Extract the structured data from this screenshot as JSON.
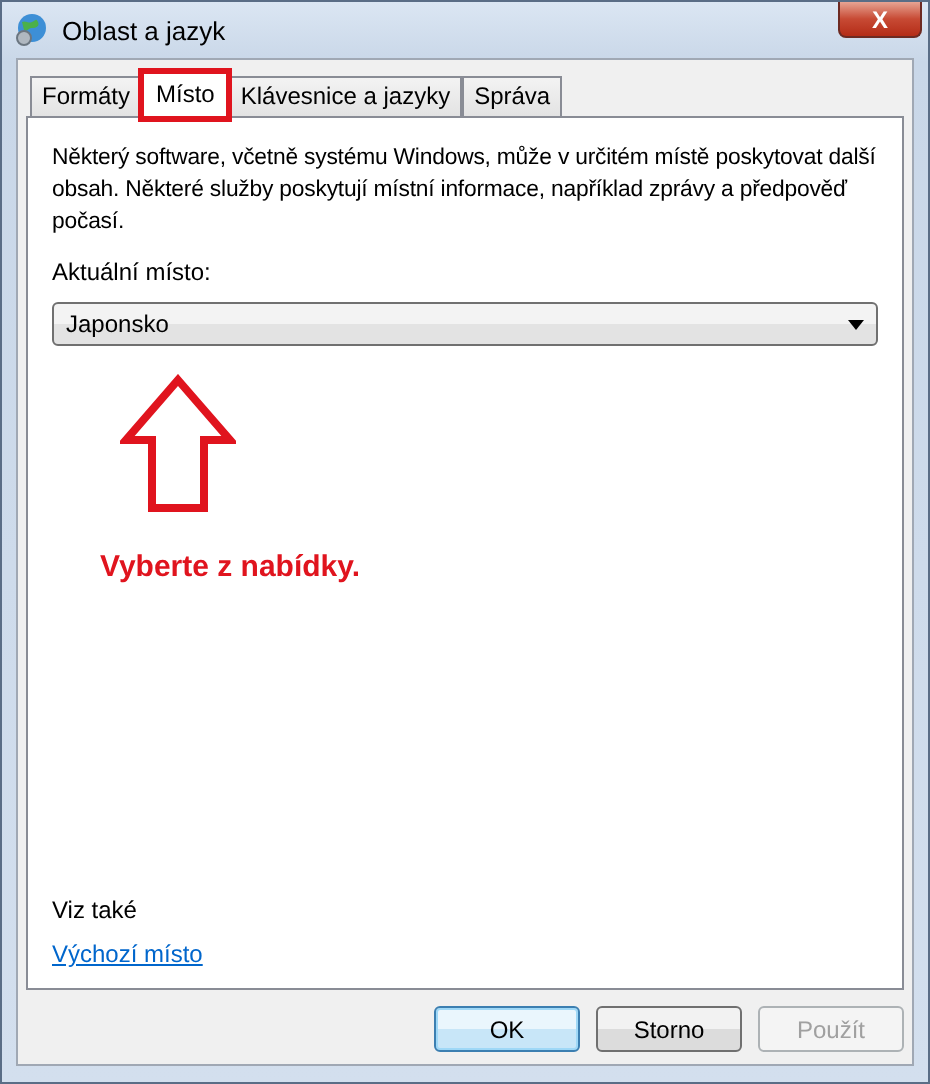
{
  "window": {
    "title": "Oblast a jazyk",
    "close_label": "X"
  },
  "tabs": [
    {
      "label": "Formáty",
      "selected": false,
      "highlighted": false
    },
    {
      "label": "Místo",
      "selected": true,
      "highlighted": true
    },
    {
      "label": "Klávesnice a jazyky",
      "selected": false,
      "highlighted": false
    },
    {
      "label": "Správa",
      "selected": false,
      "highlighted": false
    }
  ],
  "description": "Některý software, včetně systému Windows, může v určitém místě poskytovat další obsah. Některé služby poskytují místní informace, například zprávy a předpověď počasí.",
  "location": {
    "label": "Aktuální místo:",
    "value": "Japonsko"
  },
  "annotation": {
    "text": "Vyberte z nabídky."
  },
  "see_also": {
    "heading": "Viz také",
    "link": "Výchozí místo"
  },
  "buttons": [
    {
      "label": "OK",
      "default": true,
      "disabled": false
    },
    {
      "label": "Storno",
      "default": false,
      "disabled": false
    },
    {
      "label": "Použít",
      "default": false,
      "disabled": true
    }
  ]
}
